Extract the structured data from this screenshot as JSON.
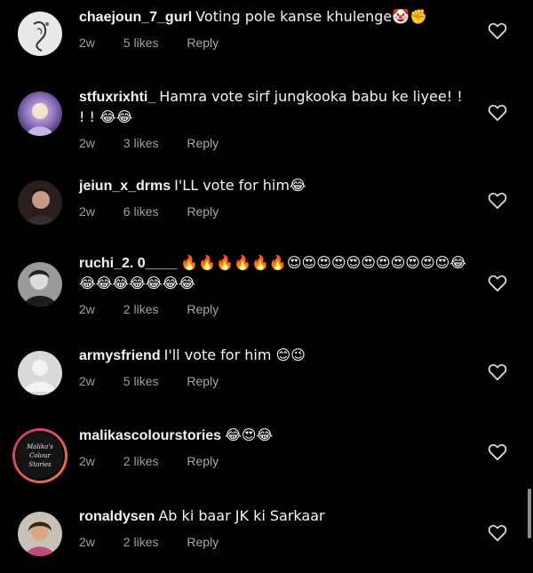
{
  "comments": [
    {
      "username": "chaejoun_7_gurl",
      "text": "Voting pole kanse khulenge🤡✊",
      "time": "2w",
      "likes": "5 likes",
      "reply": "Reply",
      "avatar_icon": "avatar-sketch-icon"
    },
    {
      "username": "stfuxrixhti_",
      "text": "Hamra vote sirf jungkooka babu ke liyee! ! ! ! 😂😂",
      "time": "2w",
      "likes": "3 likes",
      "reply": "Reply",
      "avatar_icon": "avatar-purple-photo-icon"
    },
    {
      "username": "jeiun_x_drms",
      "text": "I'LL vote for him😂",
      "time": "2w",
      "likes": "6 likes",
      "reply": "Reply",
      "avatar_icon": "avatar-dark-portrait-icon"
    },
    {
      "username": "ruchi_2. 0____",
      "text": "🔥🔥🔥🔥🔥🔥😍😍😍😍😍😍😍😍😍😍😍😂😂😂😂😂😂😂😂",
      "time": "2w",
      "likes": "2 likes",
      "reply": "Reply",
      "avatar_icon": "avatar-bw-portrait-icon"
    },
    {
      "username": "armysfriend",
      "text": "I'll vote for him 😊😉",
      "time": "2w",
      "likes": "5 likes",
      "reply": "Reply",
      "avatar_icon": "default-avatar-icon"
    },
    {
      "username": "malikascolourstories",
      "text": "😂😍😂",
      "time": "2w",
      "likes": "2 likes",
      "reply": "Reply",
      "avatar_icon": "story-ring-avatar-icon",
      "avatar_text": [
        "Malika's",
        "Colour",
        "Stories"
      ]
    },
    {
      "username": "ronaldysen",
      "text": "Ab ki baar JK ki Sarkaar",
      "time": "2w",
      "likes": "2 likes",
      "reply": "Reply",
      "avatar_icon": "avatar-photo-icon"
    }
  ],
  "colors": {
    "background": "#000000",
    "text": "#f4f4f4",
    "meta": "#a0a0a0",
    "story_ring_start": "#c13584",
    "story_ring_end": "#f77737"
  },
  "icons": {
    "like": "heart-outline-icon"
  }
}
